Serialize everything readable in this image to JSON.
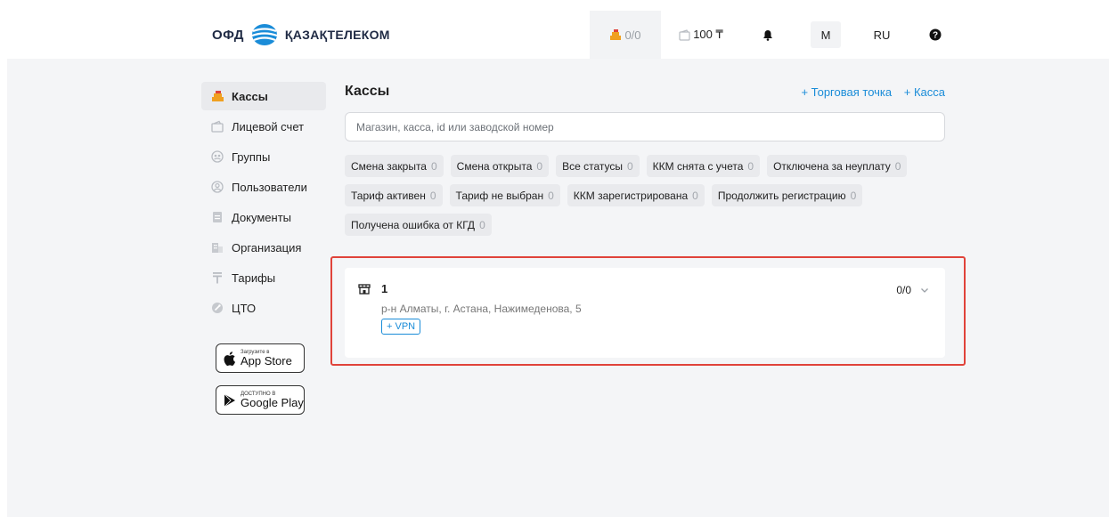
{
  "header": {
    "logo_ofd": "ОФД",
    "logo_name": "ҚАЗАҚТЕЛЕКОМ",
    "kassa_counter": "0/0",
    "balance": "100 ₸",
    "user_initial": "M",
    "language": "RU"
  },
  "sidebar": {
    "items": [
      {
        "label": "Кассы"
      },
      {
        "label": "Лицевой счет"
      },
      {
        "label": "Группы"
      },
      {
        "label": "Пользователи"
      },
      {
        "label": "Документы"
      },
      {
        "label": "Организация"
      },
      {
        "label": "Тарифы"
      },
      {
        "label": "ЦТО"
      }
    ],
    "app_store": {
      "small": "Загрузите в",
      "big": "App Store"
    },
    "google_play": {
      "small": "ДОСТУПНО В",
      "big": "Google Play"
    }
  },
  "main": {
    "title": "Кассы",
    "add_point": "+ Торговая точка",
    "add_kassa": "+ Касса",
    "search_placeholder": "Магазин, касса, id или заводской номер",
    "filters": [
      {
        "label": "Смена закрыта",
        "count": "0"
      },
      {
        "label": "Смена открыта",
        "count": "0"
      },
      {
        "label": "Все статусы",
        "count": "0"
      },
      {
        "label": "ККМ снята с учета",
        "count": "0"
      },
      {
        "label": "Отключена за неуплату",
        "count": "0"
      },
      {
        "label": "Тариф активен",
        "count": "0"
      },
      {
        "label": "Тариф не выбран",
        "count": "0"
      },
      {
        "label": "ККМ зарегистрирована",
        "count": "0"
      },
      {
        "label": "Продолжить регистрацию",
        "count": "0"
      },
      {
        "label": "Получена ошибка от КГД",
        "count": "0"
      }
    ],
    "store_card": {
      "number": "1",
      "address": "р-н Алматы, г. Астана, Нажимеденова, 5",
      "vpn_label": "+ VPN",
      "count": "0/0"
    }
  },
  "colors": {
    "accent": "#1a8cd8",
    "kassa_icon": "#f0a020",
    "highlight": "#e0433a",
    "background": "#f4f5f7"
  }
}
